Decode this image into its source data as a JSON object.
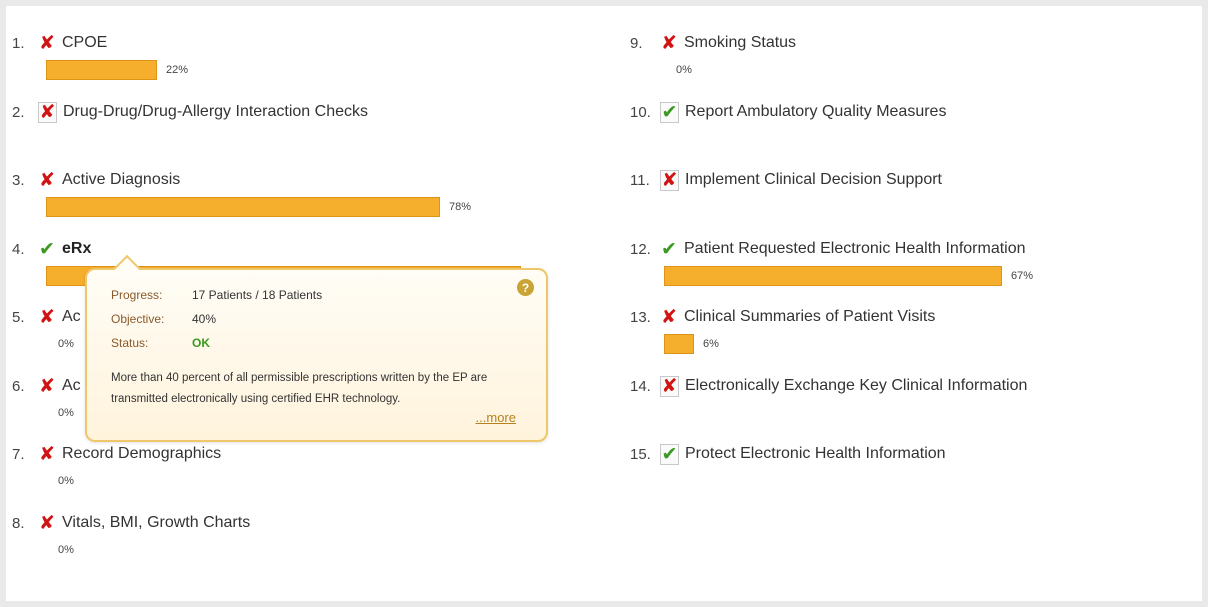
{
  "colors": {
    "bar": "#f6ae2d",
    "fail": "#d11313",
    "pass": "#3a9a1f"
  },
  "left_items": [
    {
      "number": "1.",
      "label": "CPOE",
      "status": "fail",
      "boxed": false,
      "bold": false,
      "progress_percent": 22,
      "percent_text": "22%"
    },
    {
      "number": "2.",
      "label": "Drug-Drug/Drug-Allergy Interaction Checks",
      "status": "fail",
      "boxed": true,
      "bold": false,
      "progress_percent": null,
      "percent_text": ""
    },
    {
      "number": "3.",
      "label": "Active Diagnosis",
      "status": "fail",
      "boxed": false,
      "bold": false,
      "progress_percent": 78,
      "percent_text": "78%"
    },
    {
      "number": "4.",
      "label": "eRx",
      "status": "pass",
      "boxed": false,
      "bold": true,
      "progress_percent": 94,
      "percent_text": ""
    },
    {
      "number": "5.",
      "label": "Ac",
      "status": "fail",
      "boxed": false,
      "bold": false,
      "progress_percent": 0,
      "percent_text": "0%"
    },
    {
      "number": "6.",
      "label": "Ac",
      "status": "fail",
      "boxed": false,
      "bold": false,
      "progress_percent": 0,
      "percent_text": "0%"
    },
    {
      "number": "7.",
      "label": "Record Demographics",
      "status": "fail",
      "boxed": false,
      "bold": false,
      "progress_percent": 0,
      "percent_text": "0%"
    },
    {
      "number": "8.",
      "label": "Vitals, BMI, Growth Charts",
      "status": "fail",
      "boxed": false,
      "bold": false,
      "progress_percent": 0,
      "percent_text": "0%"
    }
  ],
  "right_items": [
    {
      "number": "9.",
      "label": "Smoking Status",
      "status": "fail",
      "boxed": false,
      "bold": false,
      "progress_percent": 0,
      "percent_text": "0%"
    },
    {
      "number": "10.",
      "label": "Report Ambulatory Quality Measures",
      "status": "pass",
      "boxed": true,
      "bold": false,
      "progress_percent": null,
      "percent_text": ""
    },
    {
      "number": "11.",
      "label": "Implement Clinical Decision Support",
      "status": "fail",
      "boxed": true,
      "bold": false,
      "progress_percent": null,
      "percent_text": ""
    },
    {
      "number": "12.",
      "label": "Patient Requested Electronic Health Information",
      "status": "pass",
      "boxed": false,
      "bold": false,
      "progress_percent": 67,
      "percent_text": "67%"
    },
    {
      "number": "13.",
      "label": "Clinical Summaries of Patient Visits",
      "status": "fail",
      "boxed": false,
      "bold": false,
      "progress_percent": 6,
      "percent_text": "6%"
    },
    {
      "number": "14.",
      "label": "Electronically Exchange Key Clinical Information",
      "status": "fail",
      "boxed": true,
      "bold": false,
      "progress_percent": null,
      "percent_text": ""
    },
    {
      "number": "15.",
      "label": "Protect Electronic Health Information",
      "status": "pass",
      "boxed": true,
      "bold": false,
      "progress_percent": null,
      "percent_text": ""
    }
  ],
  "tooltip": {
    "progress_key": "Progress:",
    "progress_value": "17 Patients / 18 Patients",
    "objective_key": "Objective:",
    "objective_value": "40%",
    "status_key": "Status:",
    "status_value": "OK",
    "description": "More than 40 percent of all permissible prescriptions written by the EP are transmitted electronically using certified EHR technology.",
    "more_link": "...more",
    "help_glyph": "?"
  }
}
